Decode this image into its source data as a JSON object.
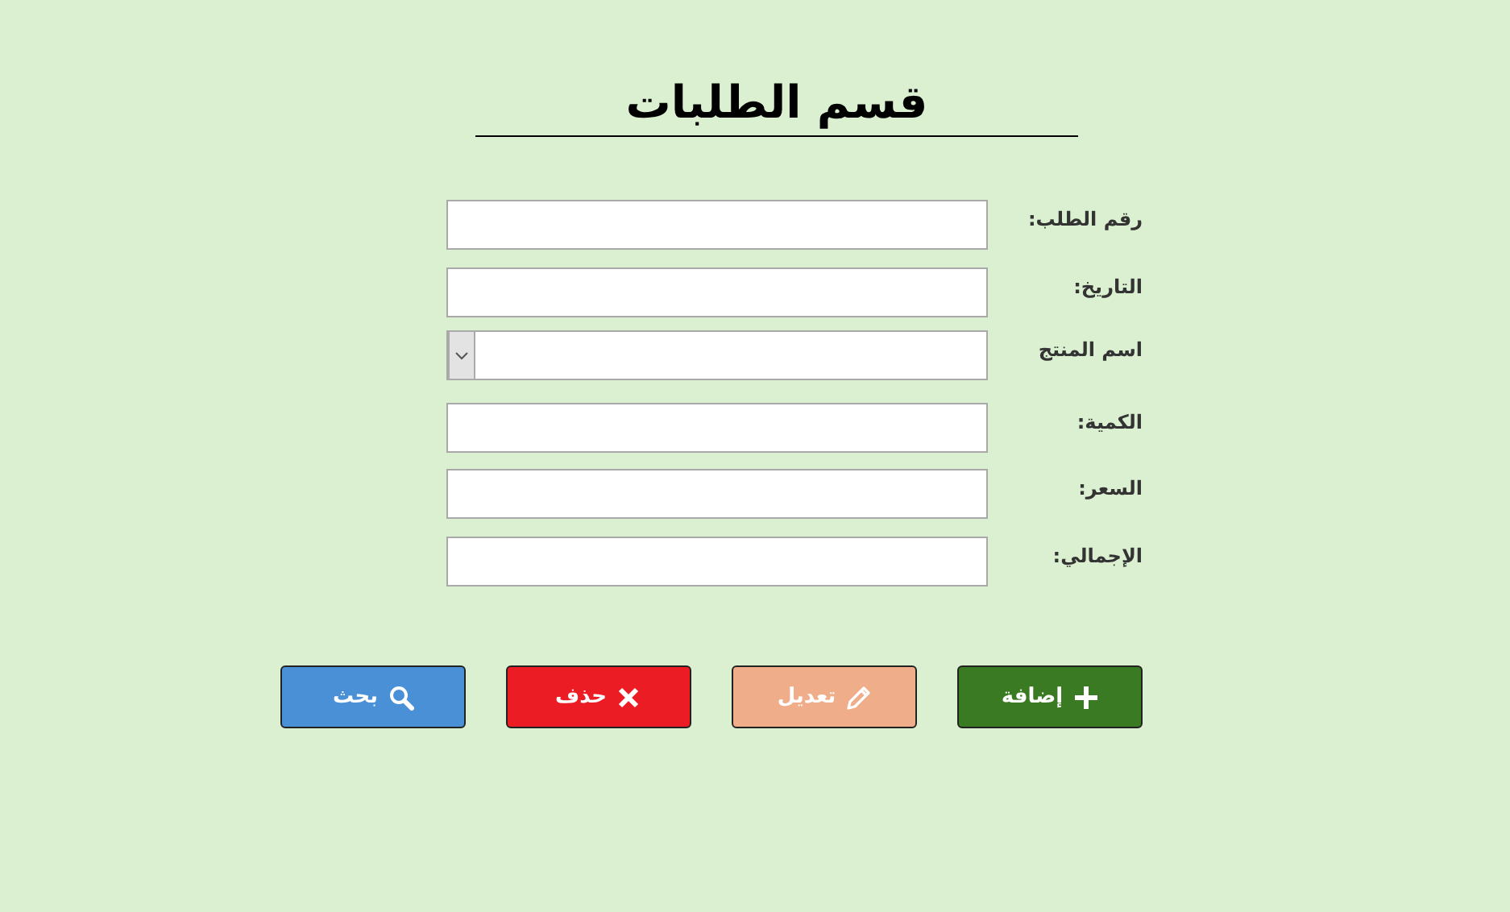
{
  "title": "قسم الطلبات",
  "fields": [
    {
      "label": "رقم الطلب:",
      "kind": "text"
    },
    {
      "label": "التاريخ:",
      "kind": "text"
    },
    {
      "label": "اسم المنتج",
      "kind": "dropdown"
    },
    {
      "label": "الكمية:",
      "kind": "text"
    },
    {
      "label": "السعر:",
      "kind": "text"
    },
    {
      "label": "الإجمالي:",
      "kind": "text"
    }
  ],
  "buttons": [
    {
      "label": "إضافة",
      "kind": "add"
    },
    {
      "label": "تعديل",
      "kind": "edit"
    },
    {
      "label": "حذف",
      "kind": "delete"
    },
    {
      "label": "بحث",
      "kind": "search"
    }
  ]
}
